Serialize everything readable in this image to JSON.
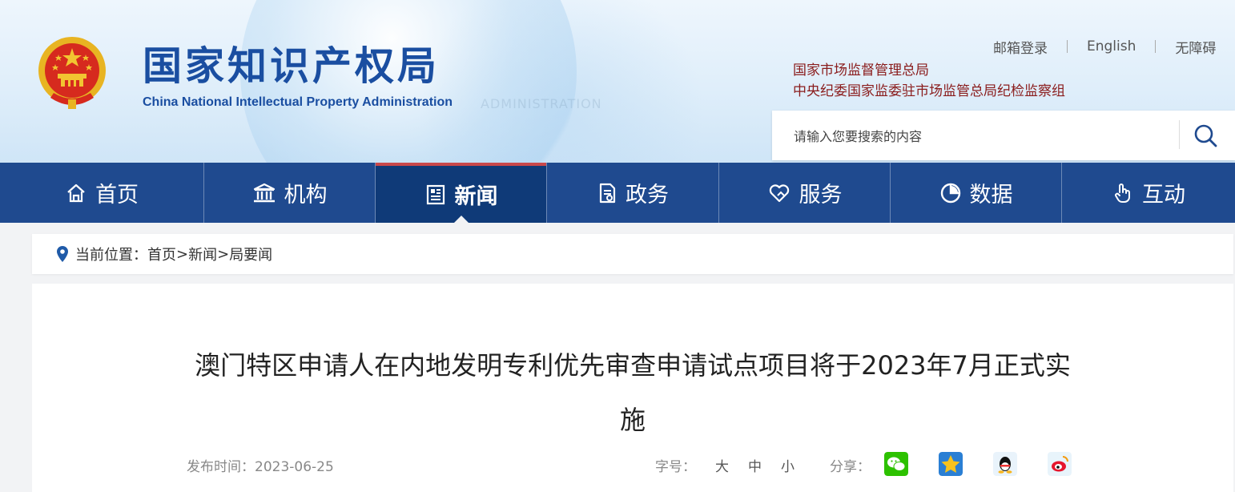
{
  "header": {
    "logo_cn": "国家知识产权局",
    "logo_en": "China National Intellectual Property Administration",
    "watermark": "ADMINISTRATION",
    "top_links": [
      "邮箱登录",
      "English",
      "无障碍"
    ],
    "gov_links": [
      "国家市场监督管理总局",
      "中央纪委国家监委驻市场监管总局纪检监察组"
    ],
    "search": {
      "placeholder": "请输入您要搜索的内容",
      "icon": "search-icon"
    }
  },
  "nav": {
    "items": [
      {
        "label": "首页",
        "icon": "home-icon"
      },
      {
        "label": "机构",
        "icon": "building-icon"
      },
      {
        "label": "新闻",
        "icon": "newspaper-icon",
        "active": true
      },
      {
        "label": "政务",
        "icon": "document-icon"
      },
      {
        "label": "服务",
        "icon": "heart-hand-icon"
      },
      {
        "label": "数据",
        "icon": "pie-chart-icon"
      },
      {
        "label": "互动",
        "icon": "hand-pointer-icon"
      }
    ],
    "active_accent": "#c9484b",
    "bg_color": "#1f4a8f"
  },
  "breadcrumb": {
    "prefix": "当前位置：",
    "items": [
      "首页",
      "新闻",
      "局要闻"
    ],
    "sep": ">"
  },
  "article": {
    "title": "澳门特区申请人在内地发明专利优先审查申请试点项目将于2023年7月正式实施",
    "date_label": "发布时间：",
    "date": "2023-06-25",
    "font_size_label": "字号：",
    "font_sizes": [
      "大",
      "中",
      "小"
    ],
    "share_label": "分享：",
    "share_icons": [
      "wechat-icon",
      "qzone-icon",
      "qq-icon",
      "weibo-icon"
    ]
  }
}
